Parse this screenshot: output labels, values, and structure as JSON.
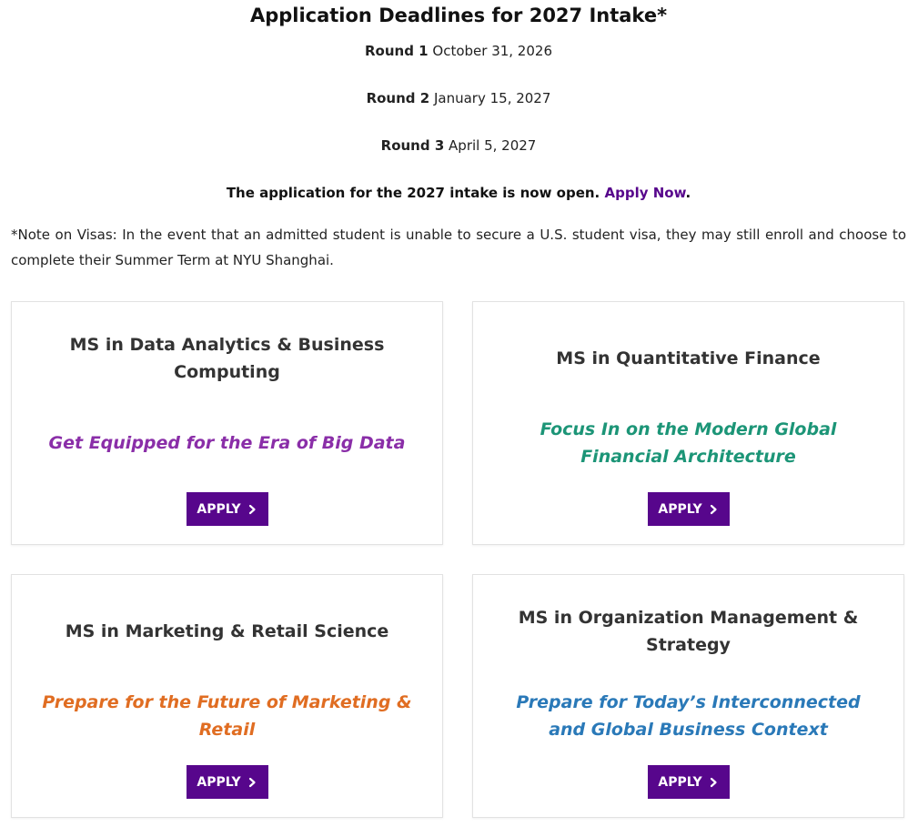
{
  "header": {
    "title": "Application Deadlines for 2027 Intake*"
  },
  "rounds": [
    {
      "label": "Round 1",
      "date": "October 31, 2026"
    },
    {
      "label": "Round 2",
      "date": "January 15, 2027"
    },
    {
      "label": "Round 3",
      "date": "April 5, 2027"
    }
  ],
  "open_notice": {
    "text": "The application for the 2027 intake is now open.",
    "link_label": "Apply Now",
    "suffix": "."
  },
  "visa_note": "*Note on Visas: In the event that an admitted student is unable to secure a U.S. student visa, they may still enroll and choose to complete their Summer Term at NYU Shanghai.",
  "colors": {
    "brand_purple": "#57068c",
    "tag_purple": "#8a2ea8",
    "tag_green": "#1c9577",
    "tag_orange": "#e06d22",
    "tag_blue": "#2a79b8"
  },
  "programs": [
    {
      "title": "MS in Data Analytics & Business Computing",
      "tagline": "Get Equipped for the Era of Big Data",
      "tagline_color": "#8a2ea8",
      "button_label": "APPLY",
      "button_icon": "chevron-right-icon"
    },
    {
      "title": "MS in Quantitative Finance",
      "tagline": "Focus In on the Modern Global Financial Architecture",
      "tagline_color": "#1c9577",
      "button_label": "APPLY",
      "button_icon": "chevron-right-icon"
    },
    {
      "title": "MS in Marketing & Retail Science",
      "tagline": "Prepare for the Future of Marketing & Retail",
      "tagline_color": "#e06d22",
      "button_label": "APPLY",
      "button_icon": "chevron-right-icon"
    },
    {
      "title": "MS in Organization Management & Strategy",
      "tagline": "Prepare for Today’s Interconnected and Global Business Context",
      "tagline_color": "#2a79b8",
      "button_label": "APPLY",
      "button_icon": "chevron-right-icon"
    }
  ]
}
